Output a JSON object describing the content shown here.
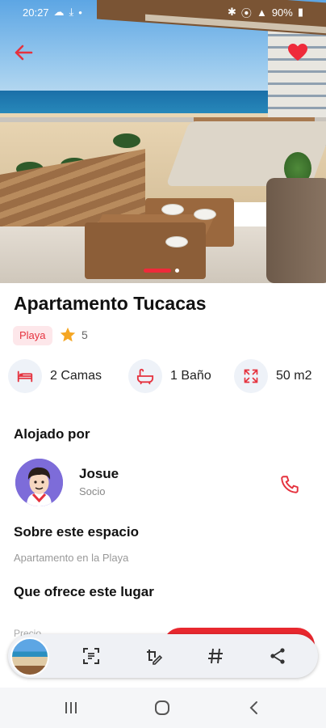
{
  "status_bar": {
    "time": "20:27",
    "battery": "90%",
    "left_icons": [
      "cloud-icon",
      "download-icon",
      "dot-icon"
    ],
    "right_icons": [
      "bluetooth-icon",
      "location-icon",
      "signal-icon",
      "battery-icon"
    ]
  },
  "listing": {
    "title": "Apartamento Tucacas",
    "tag": "Playa",
    "rating": "5",
    "amenities": [
      {
        "icon": "bed-icon",
        "label": "2 Camas"
      },
      {
        "icon": "bathtub-icon",
        "label": "1 Baño"
      },
      {
        "icon": "area-expand-icon",
        "label": "50 m2"
      }
    ]
  },
  "host": {
    "heading": "Alojado por",
    "name": "Josue",
    "role": "Socio"
  },
  "about": {
    "heading": "Sobre este espacio",
    "text": "Apartamento en la Playa"
  },
  "offers": {
    "heading": "Que ofrece este lugar",
    "first_item_partial": "Precio"
  },
  "toolbar_icons": [
    "scan-text-icon",
    "edit-crop-icon",
    "hashtag-icon",
    "share-icon"
  ],
  "nav_icons": [
    "recent-apps-icon",
    "home-icon",
    "back-icon"
  ],
  "colors": {
    "accent": "#E5323E",
    "tag_bg": "#FDE7EA",
    "amenity_bg": "#EEF2F8",
    "star": "#F5A623"
  }
}
